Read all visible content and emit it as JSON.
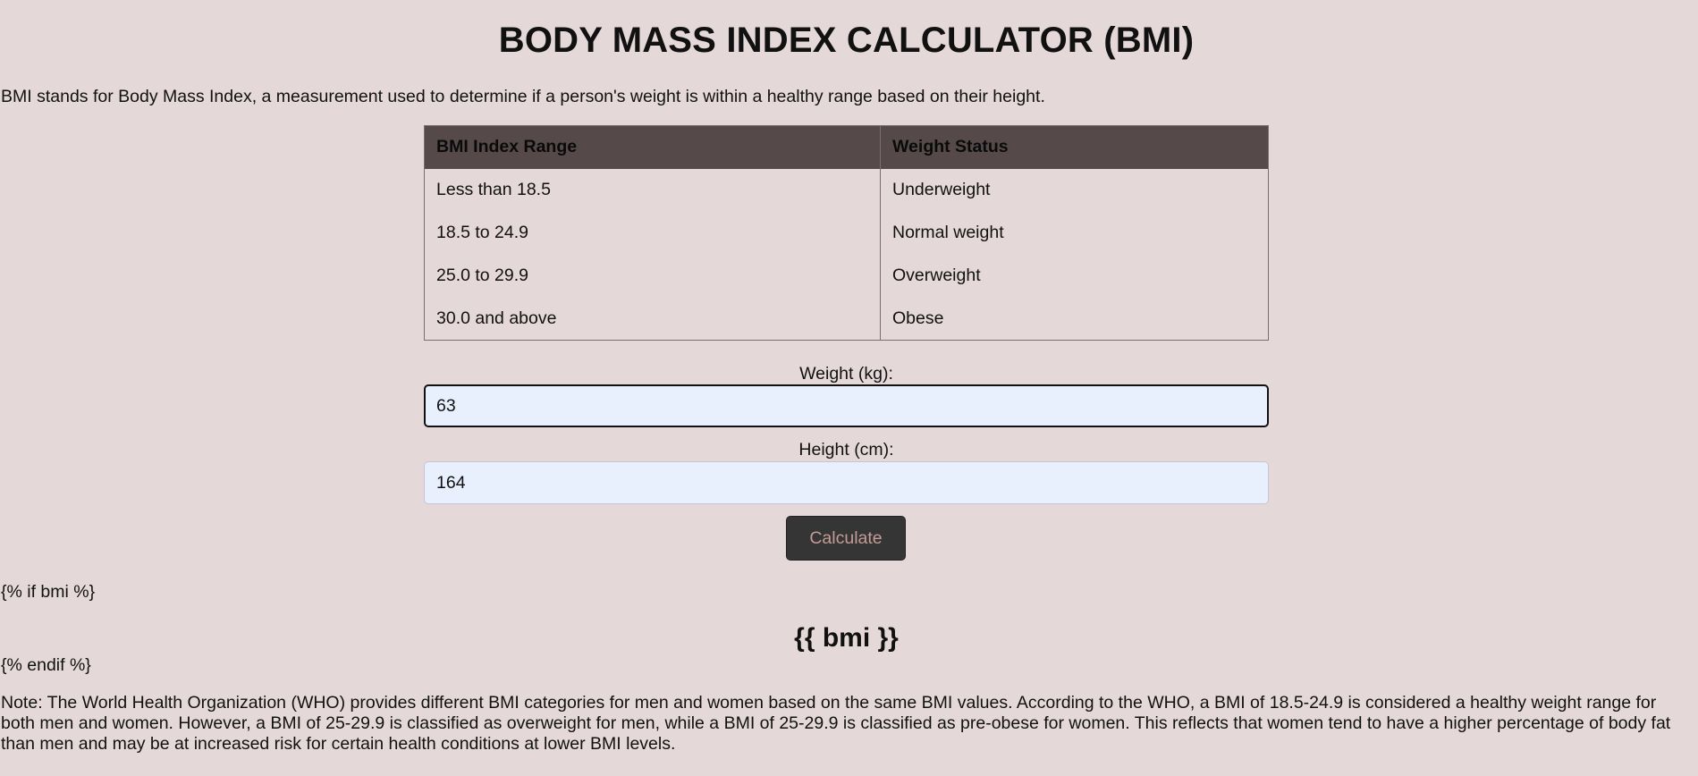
{
  "page": {
    "title": "BODY MASS INDEX CALCULATOR (BMI)",
    "intro": "BMI stands for Body Mass Index, a measurement used to determine if a person's weight is within a healthy range based on their height."
  },
  "table": {
    "headers": [
      "BMI Index Range",
      "Weight Status"
    ],
    "rows": [
      [
        "Less than 18.5",
        "Underweight"
      ],
      [
        "18.5 to 24.9",
        "Normal weight"
      ],
      [
        "25.0 to 29.9",
        "Overweight"
      ],
      [
        "30.0 and above",
        "Obese"
      ]
    ]
  },
  "form": {
    "weight_label": "Weight (kg):",
    "weight_value": "63",
    "height_label": "Height (cm):",
    "height_value": "164",
    "calculate_label": "Calculate"
  },
  "template": {
    "if_tag": "{% if bmi %}",
    "bmi_placeholder": "{{ bmi }}",
    "endif_tag": "{% endif %}"
  },
  "note": "Note: The World Health Organization (WHO) provides different BMI categories for men and women based on the same BMI values. According to the WHO, a BMI of 18.5-24.9 is considered a healthy weight range for both men and women. However, a BMI of 25-29.9 is classified as overweight for men, while a BMI of 25-29.9 is classified as pre-obese for women. This reflects that women tend to have a higher percentage of body fat than men and may be at increased risk for certain health conditions at lower BMI levels.",
  "colors": {
    "background": "#e5d8d8",
    "table_header": "#554949",
    "input_background": "#e8f0fe",
    "button_background": "#353535",
    "button_text": "#c29c95"
  }
}
